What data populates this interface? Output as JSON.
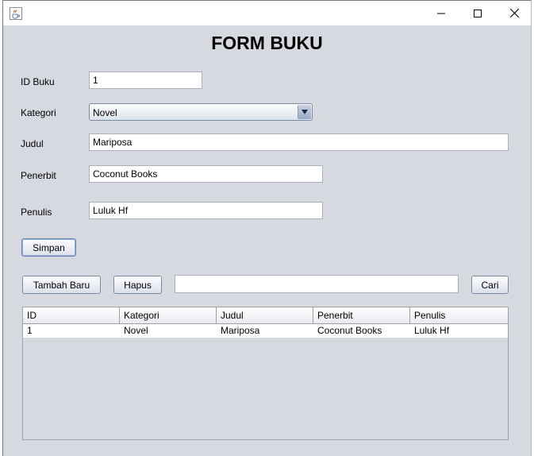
{
  "window": {
    "icon": "java-coffee-cup-icon",
    "controls": {
      "minimize": "minimize-icon",
      "maximize": "maximize-icon",
      "close": "close-icon"
    }
  },
  "form": {
    "title": "FORM BUKU",
    "id_label": "ID Buku",
    "id_value": "1",
    "category_label": "Kategori",
    "category_value": "Novel",
    "title_label": "Judul",
    "title_value": "Mariposa",
    "publisher_label": "Penerbit",
    "publisher_value": "Coconut Books",
    "author_label": "Penulis",
    "author_value": "Luluk Hf",
    "save_button": "Simpan"
  },
  "toolbar": {
    "new_button": "Tambah Baru",
    "delete_button": "Hapus",
    "search_value": "",
    "search_button": "Cari"
  },
  "table": {
    "columns": [
      "ID",
      "Kategori",
      "Judul",
      "Penerbit",
      "Penulis"
    ],
    "rows": [
      [
        "1",
        "Novel",
        "Mariposa",
        "Coconut Books",
        "Luluk Hf"
      ]
    ]
  }
}
